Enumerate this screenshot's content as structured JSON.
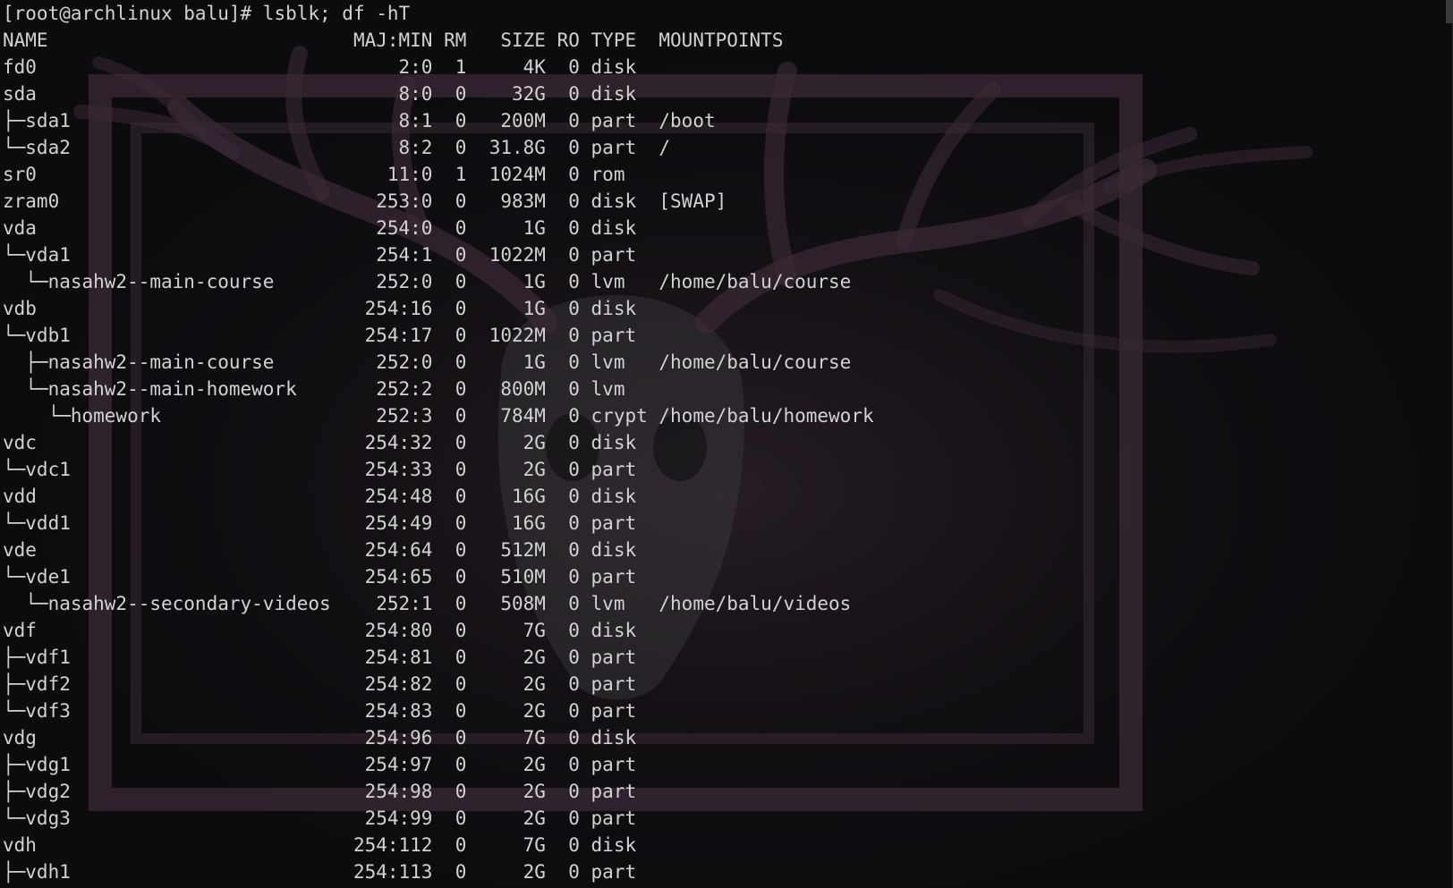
{
  "terminal": {
    "prompt": "[root@archlinux balu]# ",
    "command": "lsblk; df -hT",
    "header": {
      "name": "NAME",
      "majmin": "MAJ:MIN",
      "rm": "RM",
      "size": "SIZE",
      "ro": "RO",
      "type": "TYPE",
      "mountpoints": "MOUNTPOINTS"
    },
    "rows": [
      {
        "name": "fd0",
        "majmin": "2:0",
        "rm": "1",
        "size": "4K",
        "ro": "0",
        "type": "disk",
        "mount": ""
      },
      {
        "name": "sda",
        "majmin": "8:0",
        "rm": "0",
        "size": "32G",
        "ro": "0",
        "type": "disk",
        "mount": ""
      },
      {
        "name": "├─sda1",
        "majmin": "8:1",
        "rm": "0",
        "size": "200M",
        "ro": "0",
        "type": "part",
        "mount": "/boot"
      },
      {
        "name": "└─sda2",
        "majmin": "8:2",
        "rm": "0",
        "size": "31.8G",
        "ro": "0",
        "type": "part",
        "mount": "/"
      },
      {
        "name": "sr0",
        "majmin": "11:0",
        "rm": "1",
        "size": "1024M",
        "ro": "0",
        "type": "rom",
        "mount": ""
      },
      {
        "name": "zram0",
        "majmin": "253:0",
        "rm": "0",
        "size": "983M",
        "ro": "0",
        "type": "disk",
        "mount": "[SWAP]"
      },
      {
        "name": "vda",
        "majmin": "254:0",
        "rm": "0",
        "size": "1G",
        "ro": "0",
        "type": "disk",
        "mount": ""
      },
      {
        "name": "└─vda1",
        "majmin": "254:1",
        "rm": "0",
        "size": "1022M",
        "ro": "0",
        "type": "part",
        "mount": ""
      },
      {
        "name": "  └─nasahw2--main-course",
        "majmin": "252:0",
        "rm": "0",
        "size": "1G",
        "ro": "0",
        "type": "lvm",
        "mount": "/home/balu/course"
      },
      {
        "name": "vdb",
        "majmin": "254:16",
        "rm": "0",
        "size": "1G",
        "ro": "0",
        "type": "disk",
        "mount": ""
      },
      {
        "name": "└─vdb1",
        "majmin": "254:17",
        "rm": "0",
        "size": "1022M",
        "ro": "0",
        "type": "part",
        "mount": ""
      },
      {
        "name": "  ├─nasahw2--main-course",
        "majmin": "252:0",
        "rm": "0",
        "size": "1G",
        "ro": "0",
        "type": "lvm",
        "mount": "/home/balu/course"
      },
      {
        "name": "  └─nasahw2--main-homework",
        "majmin": "252:2",
        "rm": "0",
        "size": "800M",
        "ro": "0",
        "type": "lvm",
        "mount": ""
      },
      {
        "name": "    └─homework",
        "majmin": "252:3",
        "rm": "0",
        "size": "784M",
        "ro": "0",
        "type": "crypt",
        "mount": "/home/balu/homework"
      },
      {
        "name": "vdc",
        "majmin": "254:32",
        "rm": "0",
        "size": "2G",
        "ro": "0",
        "type": "disk",
        "mount": ""
      },
      {
        "name": "└─vdc1",
        "majmin": "254:33",
        "rm": "0",
        "size": "2G",
        "ro": "0",
        "type": "part",
        "mount": ""
      },
      {
        "name": "vdd",
        "majmin": "254:48",
        "rm": "0",
        "size": "16G",
        "ro": "0",
        "type": "disk",
        "mount": ""
      },
      {
        "name": "└─vdd1",
        "majmin": "254:49",
        "rm": "0",
        "size": "16G",
        "ro": "0",
        "type": "part",
        "mount": ""
      },
      {
        "name": "vde",
        "majmin": "254:64",
        "rm": "0",
        "size": "512M",
        "ro": "0",
        "type": "disk",
        "mount": ""
      },
      {
        "name": "└─vde1",
        "majmin": "254:65",
        "rm": "0",
        "size": "510M",
        "ro": "0",
        "type": "part",
        "mount": ""
      },
      {
        "name": "  └─nasahw2--secondary-videos",
        "majmin": "252:1",
        "rm": "0",
        "size": "508M",
        "ro": "0",
        "type": "lvm",
        "mount": "/home/balu/videos"
      },
      {
        "name": "vdf",
        "majmin": "254:80",
        "rm": "0",
        "size": "7G",
        "ro": "0",
        "type": "disk",
        "mount": ""
      },
      {
        "name": "├─vdf1",
        "majmin": "254:81",
        "rm": "0",
        "size": "2G",
        "ro": "0",
        "type": "part",
        "mount": ""
      },
      {
        "name": "├─vdf2",
        "majmin": "254:82",
        "rm": "0",
        "size": "2G",
        "ro": "0",
        "type": "part",
        "mount": ""
      },
      {
        "name": "└─vdf3",
        "majmin": "254:83",
        "rm": "0",
        "size": "2G",
        "ro": "0",
        "type": "part",
        "mount": ""
      },
      {
        "name": "vdg",
        "majmin": "254:96",
        "rm": "0",
        "size": "7G",
        "ro": "0",
        "type": "disk",
        "mount": ""
      },
      {
        "name": "├─vdg1",
        "majmin": "254:97",
        "rm": "0",
        "size": "2G",
        "ro": "0",
        "type": "part",
        "mount": ""
      },
      {
        "name": "├─vdg2",
        "majmin": "254:98",
        "rm": "0",
        "size": "2G",
        "ro": "0",
        "type": "part",
        "mount": ""
      },
      {
        "name": "└─vdg3",
        "majmin": "254:99",
        "rm": "0",
        "size": "2G",
        "ro": "0",
        "type": "part",
        "mount": ""
      },
      {
        "name": "vdh",
        "majmin": "254:112",
        "rm": "0",
        "size": "7G",
        "ro": "0",
        "type": "disk",
        "mount": ""
      },
      {
        "name": "├─vdh1",
        "majmin": "254:113",
        "rm": "0",
        "size": "2G",
        "ro": "0",
        "type": "part",
        "mount": ""
      }
    ]
  },
  "colors": {
    "background": "#0c0b0e",
    "foreground": "#d2d2d2",
    "wallpaper_tint": "#4a3846"
  }
}
